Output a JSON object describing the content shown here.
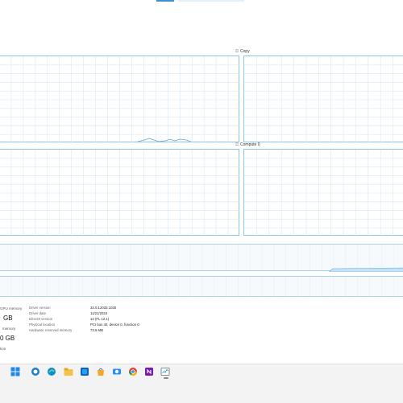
{
  "graphs": {
    "top_right_label": "Copy",
    "mid_right_label": "Compute 0",
    "label_prefix": "⎚"
  },
  "stats": {
    "dedicated_label": "GPU memory",
    "dedicated_value": "GB",
    "shared_label": "memory",
    "shared_value": "0 GB",
    "extra_label": "tion"
  },
  "details": [
    {
      "key": "Driver version",
      "value": "32.0.12033.1030"
    },
    {
      "key": "Driver date",
      "value": "11/21/2024"
    },
    {
      "key": "DirectX version",
      "value": "12 (FL 12.1)"
    },
    {
      "key": "Physical location",
      "value": "PCI bus 40, device 0, function 0"
    },
    {
      "key": "Hardware reserved memory",
      "value": "73.6 MB"
    }
  ],
  "taskbar": {
    "icons": [
      "start-icon",
      "search-icon",
      "edge-icon",
      "file-explorer-icon",
      "outlook-icon",
      "ms-store-icon",
      "camera-icon",
      "chrome-icon",
      "onenote-icon",
      "task-manager-icon"
    ]
  },
  "colors": {
    "panel_border": "#8fc2e8",
    "graph_grid": "#d7e8f5",
    "accent": "#3a8fd6",
    "taskbar": "#f3f3f3"
  }
}
